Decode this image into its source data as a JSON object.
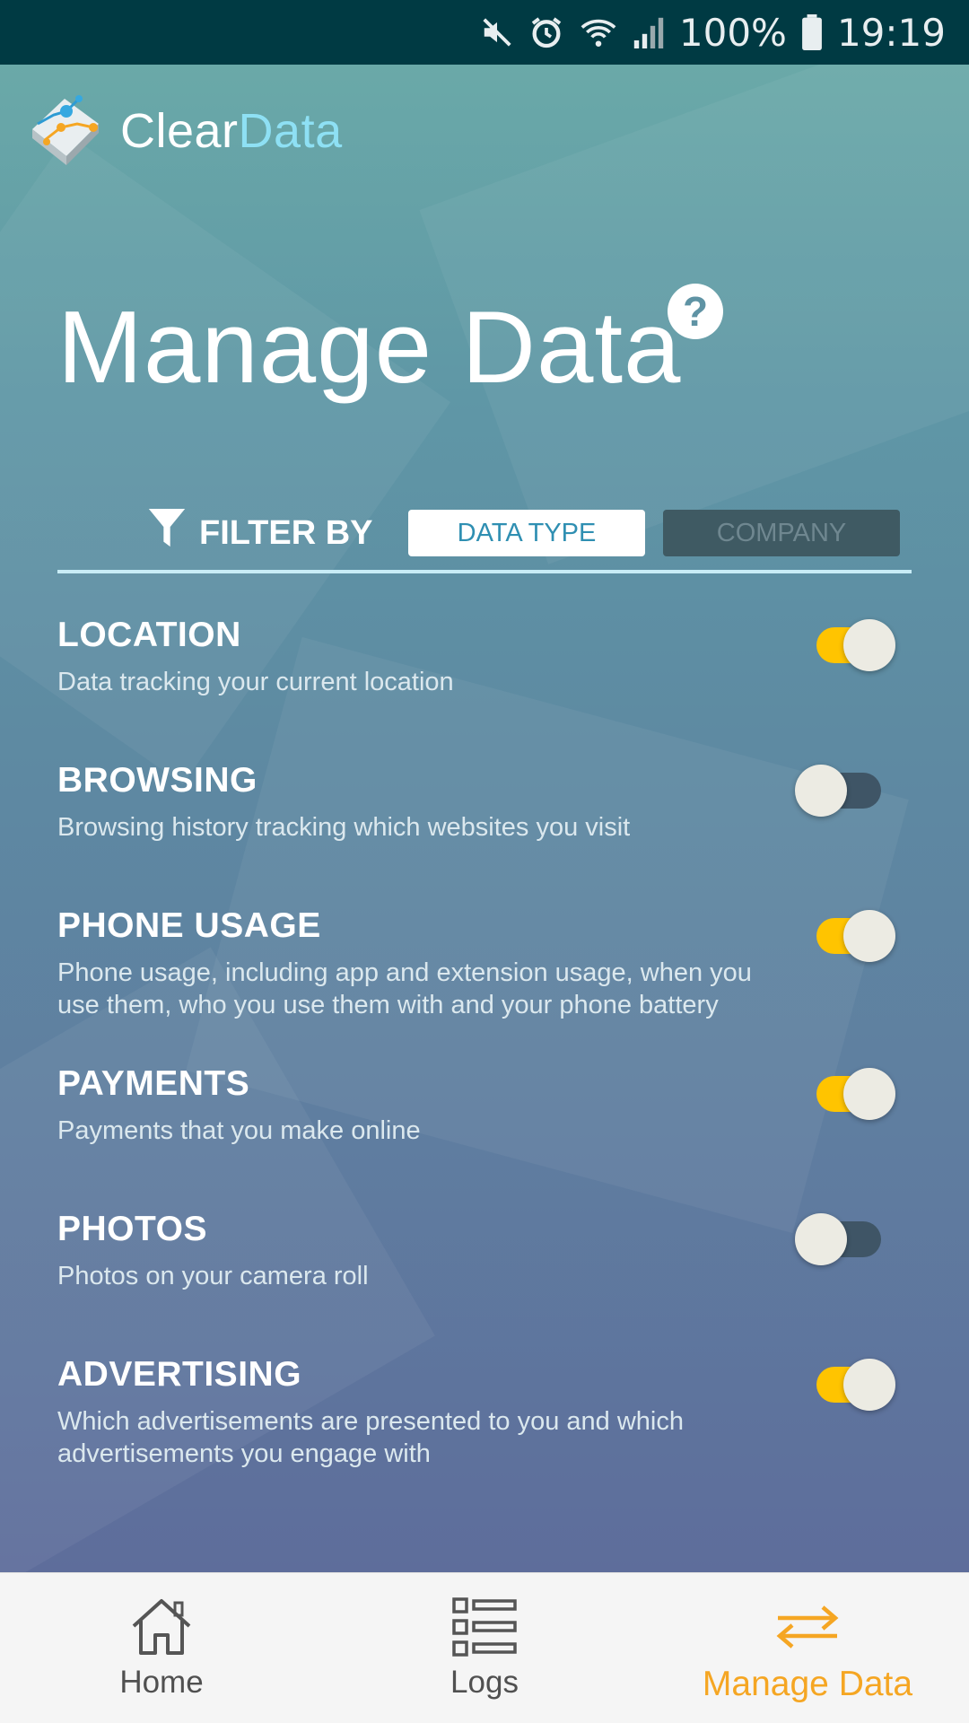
{
  "status_bar": {
    "battery": "100%",
    "time": "19:19",
    "icons": [
      "mute-icon",
      "alarm-icon",
      "wifi-icon",
      "signal-icon",
      "battery-icon"
    ]
  },
  "app": {
    "logo_part1": "Clear",
    "logo_part2": "Data"
  },
  "page": {
    "title": "Manage Data",
    "help_symbol": "?"
  },
  "filter": {
    "label": "FILTER BY",
    "options": [
      "DATA TYPE",
      "COMPANY"
    ],
    "selected": "DATA TYPE"
  },
  "items": [
    {
      "title": "LOCATION",
      "description": "Data tracking your current location",
      "enabled": true
    },
    {
      "title": "BROWSING",
      "description": "Browsing history tracking which websites you visit",
      "enabled": false
    },
    {
      "title": "PHONE USAGE",
      "description": "Phone usage, including app and extension usage, when you use them, who you use them with and your phone battery",
      "enabled": true
    },
    {
      "title": "PAYMENTS",
      "description": "Payments that you make online",
      "enabled": true
    },
    {
      "title": "PHOTOS",
      "description": "Photos on your camera roll",
      "enabled": false
    },
    {
      "title": "ADVERTISING",
      "description": "Which advertisements are presented to you and which advertisements you engage with",
      "enabled": true
    }
  ],
  "nav": {
    "items": [
      "Home",
      "Logs",
      "Manage Data"
    ],
    "active": "Manage Data"
  },
  "colors": {
    "accent": "#f5a623",
    "toggle_on": "#ffc400",
    "status_bar": "#003a43"
  }
}
